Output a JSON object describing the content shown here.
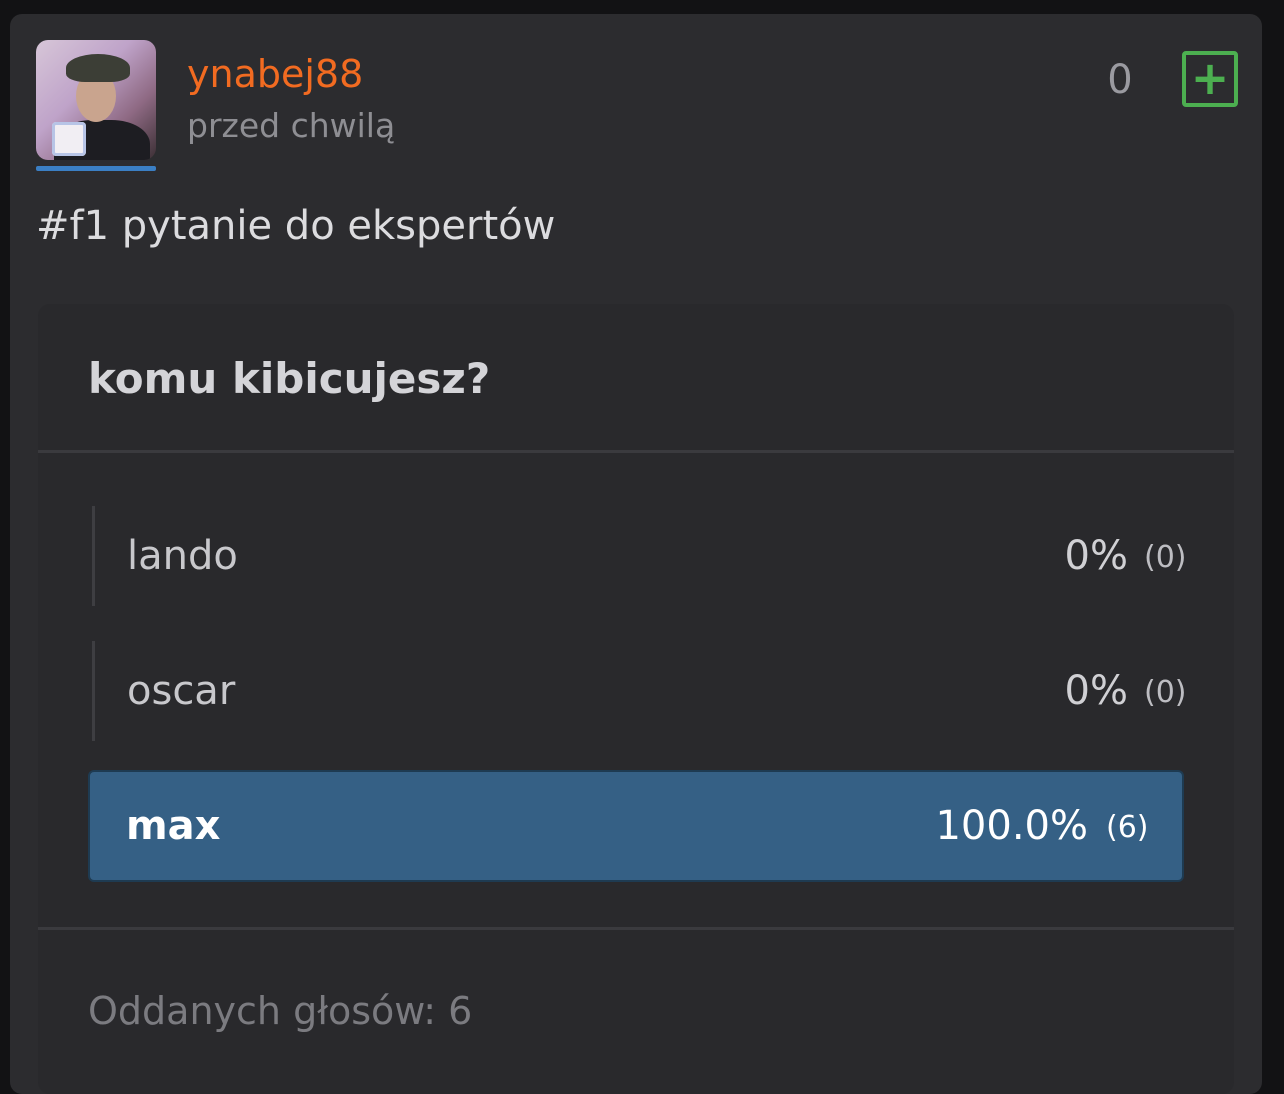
{
  "post": {
    "author": "ynabej88",
    "timestamp": "przed chwilą",
    "vote_count": "0",
    "plus_symbol": "+",
    "text": "#f1 pytanie do ekspertów"
  },
  "poll": {
    "question": "komu kibicujesz?",
    "options": [
      {
        "label": "lando",
        "percent": "0%",
        "count": "(0)",
        "selected": false
      },
      {
        "label": "oscar",
        "percent": "0%",
        "count": "(0)",
        "selected": false
      },
      {
        "label": "max",
        "percent": "100.0%",
        "count": "(6)",
        "selected": true
      }
    ],
    "total": "Oddanych głosów: 6"
  },
  "colors": {
    "username": "#f26b21",
    "plus_button": "#4caf50",
    "selected_option": "#356085",
    "avatar_bar": "#3b7fc4"
  },
  "icons": {
    "plus": "plus-square-icon"
  }
}
